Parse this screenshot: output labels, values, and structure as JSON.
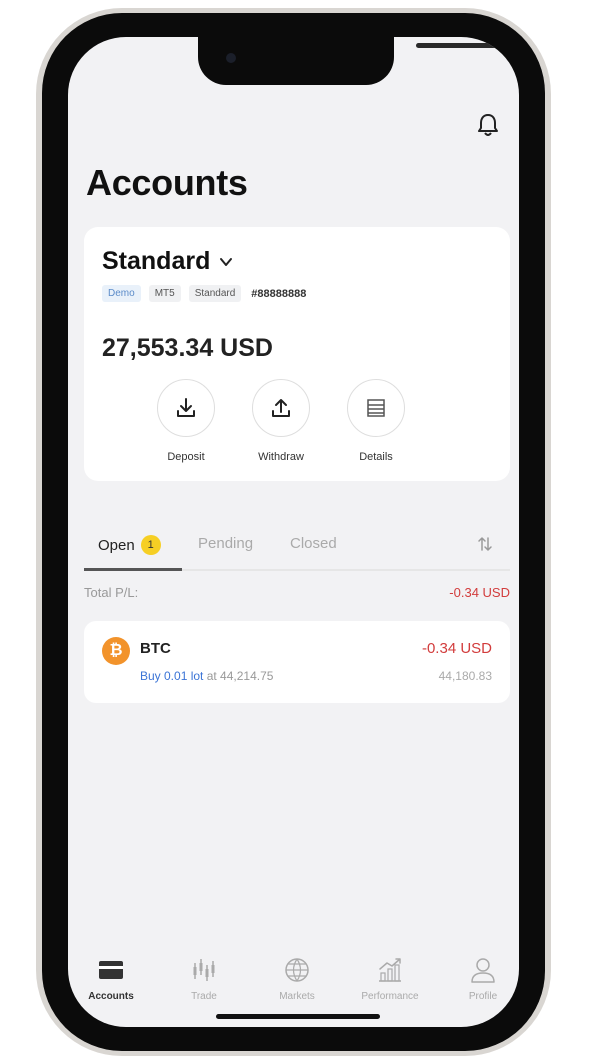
{
  "header": {
    "title": "Accounts",
    "notification_icon": "bell-icon"
  },
  "account": {
    "type": "Standard",
    "tags": [
      "Demo",
      "MT5",
      "Standard"
    ],
    "number": "#88888888",
    "balance": "27,553.34 USD",
    "actions": [
      {
        "label": "Deposit",
        "icon": "download-icon"
      },
      {
        "label": "Withdraw",
        "icon": "upload-icon"
      },
      {
        "label": "Details",
        "icon": "list-icon"
      }
    ]
  },
  "tabs": {
    "open": "Open",
    "open_count": "1",
    "pending": "Pending",
    "closed": "Closed"
  },
  "summary": {
    "label": "Total P/L:",
    "value": "-0.34 USD"
  },
  "position": {
    "symbol": "BTC",
    "side": "Buy 0.01 lot",
    "at_price": "at 44,214.75",
    "current_price": "44,180.83",
    "pl": "-0.34 USD"
  },
  "nav": [
    {
      "label": "Accounts",
      "icon": "wallet-icon",
      "active": true
    },
    {
      "label": "Trade",
      "icon": "candlestick-icon",
      "active": false
    },
    {
      "label": "Markets",
      "icon": "globe-icon",
      "active": false
    },
    {
      "label": "Performance",
      "icon": "chart-icon",
      "active": false
    },
    {
      "label": "Profile",
      "icon": "user-icon",
      "active": false
    }
  ],
  "colors": {
    "accent": "#f6cf24",
    "loss": "#d23c3c",
    "link": "#3b74d6",
    "btc": "#f2932b"
  }
}
